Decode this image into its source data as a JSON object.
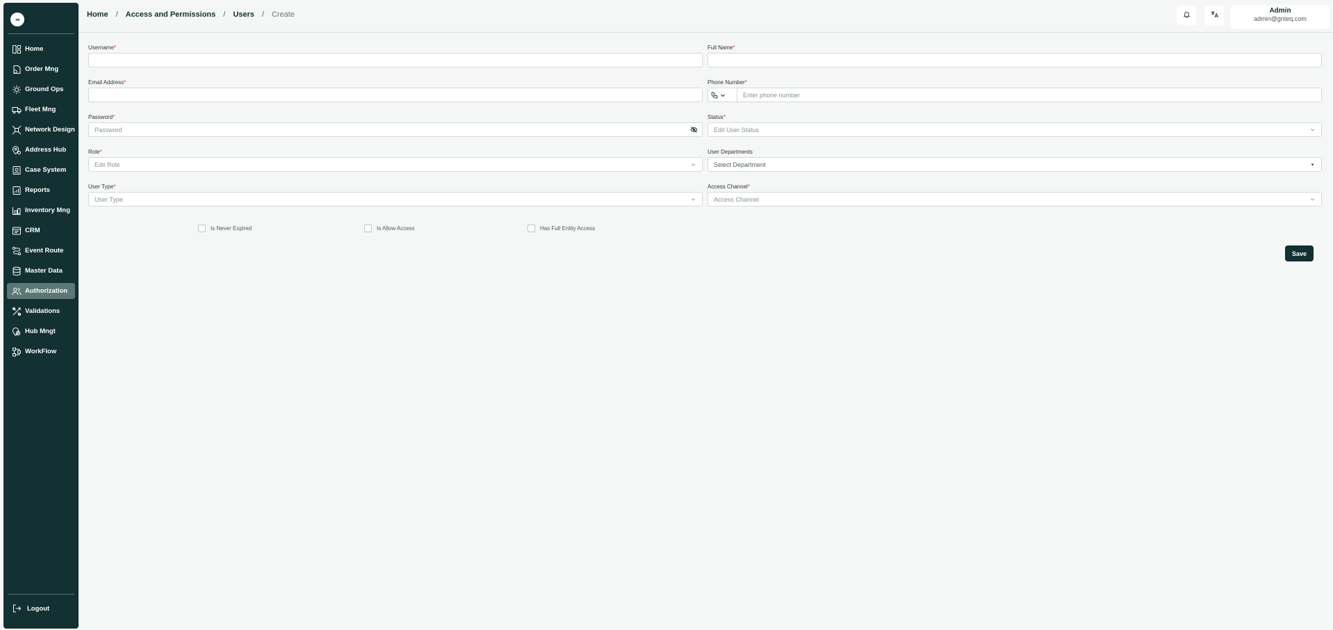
{
  "app": {
    "logo_text": "∞"
  },
  "sidebar": {
    "items": [
      {
        "label": "Home",
        "icon": "dashboard-icon",
        "active": false
      },
      {
        "label": "Order Mng",
        "icon": "order-icon",
        "active": false
      },
      {
        "label": "Ground Ops",
        "icon": "ground-ops-icon",
        "active": false
      },
      {
        "label": "Fleet Mng",
        "icon": "truck-icon",
        "active": false
      },
      {
        "label": "Network Design",
        "icon": "network-icon",
        "active": false
      },
      {
        "label": "Address Hub",
        "icon": "location-pin-icon",
        "active": false
      },
      {
        "label": "Case System",
        "icon": "case-icon",
        "active": false
      },
      {
        "label": "Reports",
        "icon": "report-icon",
        "active": false
      },
      {
        "label": "Inventory Mng",
        "icon": "inventory-icon",
        "active": false
      },
      {
        "label": "CRM",
        "icon": "crm-icon",
        "active": false
      },
      {
        "label": "Event Route",
        "icon": "route-icon",
        "active": false
      },
      {
        "label": "Master Data",
        "icon": "database-icon",
        "active": false
      },
      {
        "label": "Authorization",
        "icon": "users-icon",
        "active": true
      },
      {
        "label": "Validations",
        "icon": "validation-icon",
        "active": false
      },
      {
        "label": "Hub Mngt",
        "icon": "hub-icon",
        "active": false
      },
      {
        "label": "WorkFlow",
        "icon": "workflow-icon",
        "active": false
      }
    ],
    "logout_label": "Logout"
  },
  "header": {
    "breadcrumb": [
      "Home",
      "Access and Permissions",
      "Users"
    ],
    "breadcrumb_sep": "/",
    "breadcrumb_current": "Create",
    "user_name": "Admin",
    "user_email": "admin@gnteq.com"
  },
  "form": {
    "required_mark": "*",
    "username": {
      "label": "Username",
      "value": ""
    },
    "full_name": {
      "label": "Full Name",
      "value": ""
    },
    "email": {
      "label": "Email Address",
      "value": ""
    },
    "phone": {
      "label": "Phone Number",
      "placeholder": "Enter phone number"
    },
    "password": {
      "label": "Password",
      "placeholder": "Password"
    },
    "status": {
      "label": "Status",
      "placeholder": "Edit User Status"
    },
    "role": {
      "label": "Role",
      "placeholder": "Edit Role"
    },
    "departments": {
      "label": "User Departments",
      "placeholder": "Select Department"
    },
    "user_type": {
      "label": "User Type",
      "placeholder": "User Type"
    },
    "access_channel": {
      "label": "Access Channel",
      "placeholder": "Access Channel"
    },
    "checkboxes": [
      {
        "label": "Is Never Expired",
        "checked": false
      },
      {
        "label": "Is Allow Access",
        "checked": false
      },
      {
        "label": "Has Full Entity Access",
        "checked": false
      }
    ],
    "save_label": "Save"
  },
  "colors": {
    "sidebar_bg": "#133032",
    "active_item_bg": "#5c7876",
    "required": "#d32f2f",
    "page_bg": "#f5f7f6"
  }
}
